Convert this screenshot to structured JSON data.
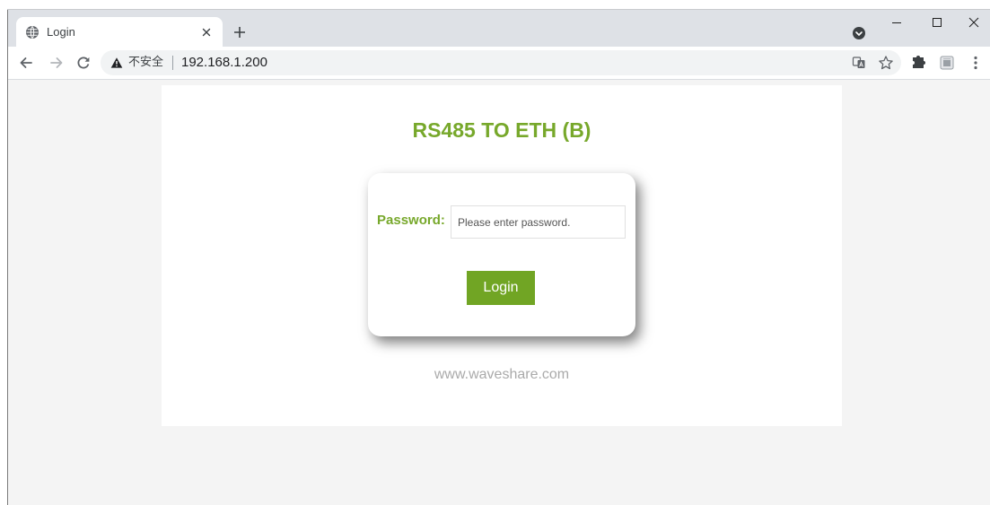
{
  "browser": {
    "tab": {
      "title": "Login",
      "favicon": "globe-icon",
      "close_icon": "close-tab-icon",
      "active": true
    },
    "new_tab_icon": "plus-icon",
    "tab_search_icon": "tab-search-icon",
    "window_controls": {
      "minimize_icon": "minimize-icon",
      "maximize_icon": "maximize-icon",
      "close_icon": "close-window-icon"
    },
    "toolbar": {
      "back_icon": "back-arrow-icon",
      "forward_icon": "forward-arrow-icon",
      "forward_enabled": false,
      "reload_icon": "reload-icon",
      "omnibox": {
        "security_icon": "warning-icon",
        "security_label": "不安全",
        "url": "192.168.1.200",
        "translate_icon": "translate-icon",
        "bookmark_icon": "star-icon"
      },
      "extensions_icon": "puzzle-icon",
      "pinned_extension_icon": "pinned-extension-icon",
      "menu_icon": "kebab-menu-icon"
    }
  },
  "page": {
    "title": "RS485 TO ETH (B)",
    "login": {
      "password_label": "Password:",
      "password_placeholder": "Please enter password.",
      "password_value": "",
      "button_label": "Login"
    },
    "footer": "www.waveshare.com"
  },
  "colors": {
    "brand_green": "#77a82b",
    "button_green": "#71a524",
    "footer_gray": "#aaaaaa",
    "page_background": "#f4f4f4",
    "panel_background": "#ffffff",
    "tabstrip_background": "#dee1e6",
    "omnibox_background": "#f1f3f4"
  }
}
